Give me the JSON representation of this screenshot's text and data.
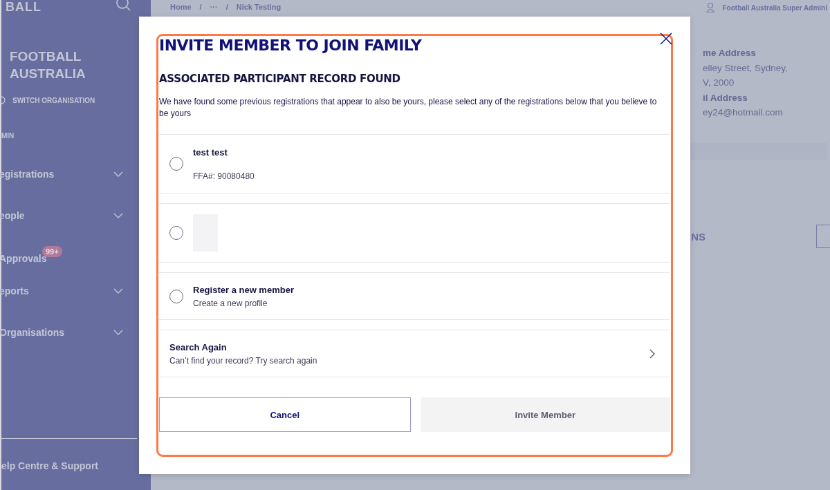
{
  "sidebar": {
    "logo": "BALL",
    "org_name": "FOOTBALL AUSTRALIA",
    "switch_label": "SWITCH ORGANISATION",
    "section": "MIN",
    "items": [
      {
        "label": "egistrations",
        "expandable": true
      },
      {
        "label": "eople",
        "expandable": true
      },
      {
        "label": "Approvals",
        "expandable": false,
        "badge": "99+"
      },
      {
        "label": "eports",
        "expandable": true
      },
      {
        "label": "Organisations",
        "expandable": true
      }
    ],
    "footer": "elp Centre & Support"
  },
  "topbar": {
    "breadcrumb": [
      "Home",
      "···",
      "Nick Testing"
    ],
    "separator": "/",
    "user": "Football Australia Super Admini"
  },
  "details": [
    {
      "kind": "label",
      "text": "me Address"
    },
    {
      "kind": "value",
      "text": "elley Street, Sydney,"
    },
    {
      "kind": "value",
      "text": "V, 2000"
    },
    {
      "kind": "label",
      "text": "il Address"
    },
    {
      "kind": "value",
      "text": "ey24@hotmail.com"
    }
  ],
  "section_heading": "NS",
  "modal": {
    "title": "INVITE MEMBER TO JOIN FAMILY",
    "subtitle": "ASSOCIATED PARTICIPANT RECORD FOUND",
    "description": "We have found some previous registrations that appear to also be yours, please select any of the registrations below that you believe to be yours",
    "options": [
      {
        "kind": "record",
        "title": "test test",
        "detail": "FFA#: 90080480",
        "selected": false
      },
      {
        "kind": "blank",
        "selected": false
      },
      {
        "kind": "new",
        "title": "Register a new member",
        "detail": "Create a new profile",
        "selected": false
      }
    ],
    "search_again": {
      "title": "Search Again",
      "detail": "Can’t find your record? Try search again"
    },
    "buttons": [
      {
        "label": "Cancel",
        "kind": "secondary",
        "disabled": false
      },
      {
        "label": "Invite Member",
        "kind": "primary",
        "disabled": true
      }
    ]
  }
}
